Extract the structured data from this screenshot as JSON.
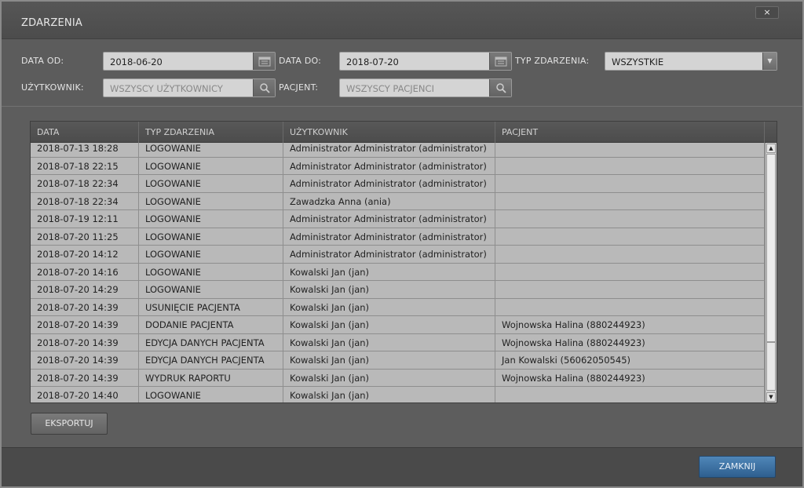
{
  "dialog": {
    "title": "ZDARZENIA",
    "close_glyph": "×"
  },
  "filters": {
    "date_from": {
      "label": "DATA OD:",
      "value": "2018-06-20"
    },
    "date_to": {
      "label": "DATA DO:",
      "value": "2018-07-20"
    },
    "event_type": {
      "label": "TYP ZDARZENIA:",
      "value": "WSZYSTKIE"
    },
    "user": {
      "label": "UŻYTKOWNIK:",
      "placeholder": "WSZYSCY UŻYTKOWNICY"
    },
    "patient": {
      "label": "PACJENT:",
      "placeholder": "WSZYSCY PACJENCI"
    }
  },
  "table": {
    "columns": [
      "DATA",
      "TYP ZDARZENIA",
      "UŻYTKOWNIK",
      "PACJENT"
    ],
    "rows": [
      [
        "2018-07-13 18:28",
        "LOGOWANIE",
        "Administrator Administrator (administrator)",
        ""
      ],
      [
        "2018-07-18 22:15",
        "LOGOWANIE",
        "Administrator Administrator (administrator)",
        ""
      ],
      [
        "2018-07-18 22:34",
        "LOGOWANIE",
        "Administrator Administrator (administrator)",
        ""
      ],
      [
        "2018-07-18 22:34",
        "LOGOWANIE",
        "Zawadzka Anna (ania)",
        ""
      ],
      [
        "2018-07-19 12:11",
        "LOGOWANIE",
        "Administrator Administrator (administrator)",
        ""
      ],
      [
        "2018-07-20 11:25",
        "LOGOWANIE",
        "Administrator Administrator (administrator)",
        ""
      ],
      [
        "2018-07-20 14:12",
        "LOGOWANIE",
        "Administrator Administrator (administrator)",
        ""
      ],
      [
        "2018-07-20 14:16",
        "LOGOWANIE",
        "Kowalski Jan (jan)",
        ""
      ],
      [
        "2018-07-20 14:29",
        "LOGOWANIE",
        "Kowalski Jan (jan)",
        ""
      ],
      [
        "2018-07-20 14:39",
        "USUNIĘCIE PACJENTA",
        "Kowalski Jan (jan)",
        ""
      ],
      [
        "2018-07-20 14:39",
        "DODANIE PACJENTA",
        "Kowalski Jan (jan)",
        "Wojnowska Halina (880244923)"
      ],
      [
        "2018-07-20 14:39",
        "EDYCJA DANYCH PACJENTA",
        "Kowalski Jan (jan)",
        "Wojnowska Halina (880244923)"
      ],
      [
        "2018-07-20 14:39",
        "EDYCJA DANYCH PACJENTA",
        "Kowalski Jan (jan)",
        "Jan Kowalski (56062050545)"
      ],
      [
        "2018-07-20 14:39",
        "WYDRUK RAPORTU",
        "Kowalski Jan (jan)",
        "Wojnowska Halina (880244923)"
      ],
      [
        "2018-07-20 14:40",
        "LOGOWANIE",
        "Kowalski Jan (jan)",
        ""
      ]
    ]
  },
  "buttons": {
    "export": "EKSPORTUJ",
    "close": "ZAMKNIJ"
  },
  "colors": {
    "primary_button": "#3a6d9e",
    "background": "#5d5d5d",
    "table_row": "#b9b9b9"
  },
  "icons": {
    "date_picker": "calendar-icon",
    "search": "search-icon",
    "dropdown": "chevron-down-icon"
  }
}
